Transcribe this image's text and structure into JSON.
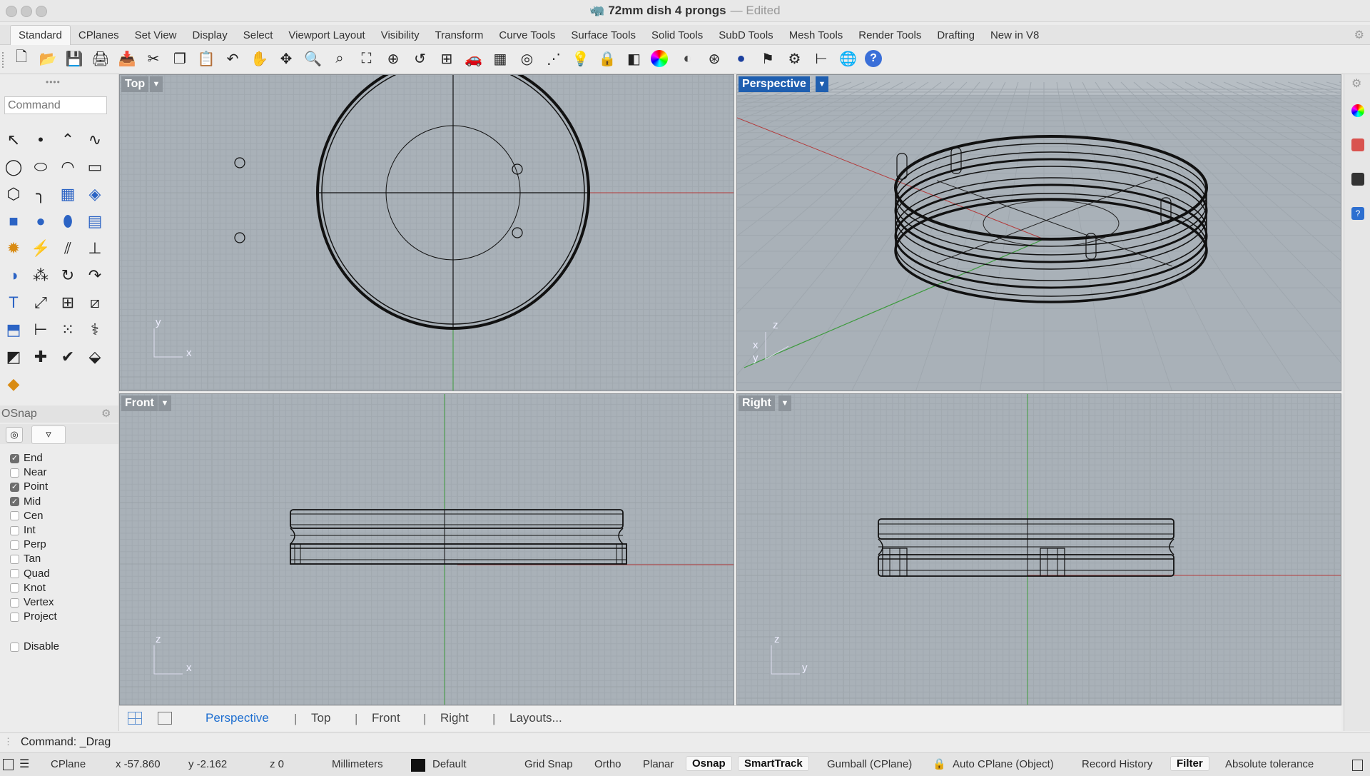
{
  "window": {
    "title": "72mm dish 4 prongs",
    "title_suffix": "— Edited",
    "doc_icon": "rhino-document-icon"
  },
  "tabs": [
    {
      "label": "Standard",
      "active": true
    },
    {
      "label": "CPlanes"
    },
    {
      "label": "Set View"
    },
    {
      "label": "Display"
    },
    {
      "label": "Select"
    },
    {
      "label": "Viewport Layout"
    },
    {
      "label": "Visibility"
    },
    {
      "label": "Transform"
    },
    {
      "label": "Curve Tools"
    },
    {
      "label": "Surface Tools"
    },
    {
      "label": "Solid Tools"
    },
    {
      "label": "SubD Tools"
    },
    {
      "label": "Mesh Tools"
    },
    {
      "label": "Render Tools"
    },
    {
      "label": "Drafting"
    },
    {
      "label": "New in V8"
    }
  ],
  "toolbar_icons": [
    "new-icon",
    "open-icon",
    "save-icon",
    "print-icon",
    "import-icon",
    "cut-icon",
    "copy-icon",
    "paste-icon",
    "undo-icon",
    "pan-icon",
    "rotate-view-icon",
    "zoom-icon",
    "zoom-window-icon",
    "zoom-extents-icon",
    "zoom-selected-icon",
    "undo-view-icon",
    "four-viewports-icon",
    "car-icon",
    "cplane-icon",
    "osnap-icon",
    "select-points-icon",
    "light-icon",
    "lock-icon",
    "layer-icon",
    "color-wheel-icon",
    "rendered-sphere-icon",
    "wireframe-sphere-icon",
    "render-icon",
    "flag-icon",
    "options-gear-icon",
    "dimension-icon",
    "rhino-globe-icon",
    "help-icon"
  ],
  "command": {
    "placeholder": "Command",
    "history": "Command: _Drag"
  },
  "osnap": {
    "title": "OSnap",
    "items": [
      {
        "label": "End",
        "checked": true
      },
      {
        "label": "Near",
        "checked": false
      },
      {
        "label": "Point",
        "checked": true
      },
      {
        "label": "Mid",
        "checked": true
      },
      {
        "label": "Cen",
        "checked": false
      },
      {
        "label": "Int",
        "checked": false
      },
      {
        "label": "Perp",
        "checked": false
      },
      {
        "label": "Tan",
        "checked": false
      },
      {
        "label": "Quad",
        "checked": false
      },
      {
        "label": "Knot",
        "checked": false
      },
      {
        "label": "Vertex",
        "checked": false
      },
      {
        "label": "Project",
        "checked": false
      }
    ],
    "disable": {
      "label": "Disable",
      "checked": false
    }
  },
  "viewports": {
    "top": {
      "label": "Top",
      "axis_a": "y",
      "axis_b": "x"
    },
    "perspective": {
      "label": "Perspective",
      "active": true,
      "axis_z": "z",
      "axis_x": "x",
      "axis_y": "y"
    },
    "front": {
      "label": "Front",
      "axis_a": "z",
      "axis_b": "x"
    },
    "right": {
      "label": "Right",
      "axis_a": "z",
      "axis_b": "y"
    }
  },
  "view_tabs": [
    {
      "label": "Perspective",
      "active": true
    },
    {
      "label": "Top"
    },
    {
      "label": "Front"
    },
    {
      "label": "Right"
    },
    {
      "label": "Layouts..."
    }
  ],
  "status": {
    "cplane": "CPlane",
    "x": "x -57.860",
    "y": "y -2.162",
    "z": "z 0",
    "units": "Millimeters",
    "layer": "Default",
    "layer_color": "#111111",
    "grid_snap": "Grid Snap",
    "ortho": "Ortho",
    "planar": "Planar",
    "osnap": "Osnap",
    "smarttrack": "SmartTrack",
    "gumball": "Gumball (CPlane)",
    "auto_cplane": "Auto CPlane (Object)",
    "record_history": "Record History",
    "filter": "Filter",
    "tolerance": "Absolute tolerance"
  },
  "colors": {
    "accent": "#1f5fb0",
    "viewport_bg": "#a9b1b8",
    "x_axis": "#b33a3a",
    "y_axis": "#3d9a3d"
  }
}
